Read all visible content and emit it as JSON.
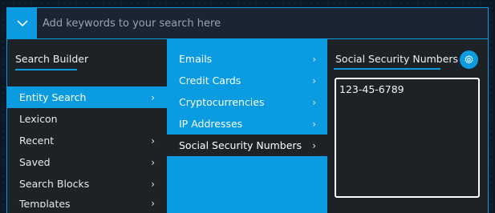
{
  "search": {
    "placeholder": "Add keywords to your search here",
    "value": ""
  },
  "builder": {
    "title": "Search Builder",
    "items": [
      {
        "label": "Entity Search",
        "chevron": "›",
        "active": true
      },
      {
        "label": "Lexicon",
        "chevron": "",
        "active": false
      },
      {
        "label": "Recent",
        "chevron": "›",
        "active": false
      },
      {
        "label": "Saved",
        "chevron": "›",
        "active": false
      },
      {
        "label": "Search Blocks",
        "chevron": "›",
        "active": false
      },
      {
        "label": "Templates",
        "chevron": "›",
        "active": false
      }
    ]
  },
  "entities": {
    "items": [
      {
        "label": "Emails",
        "chevron": "›",
        "active": false
      },
      {
        "label": "Credit Cards",
        "chevron": "›",
        "active": false
      },
      {
        "label": "Cryptocurrencies",
        "chevron": "›",
        "active": false
      },
      {
        "label": "IP Addresses",
        "chevron": "›",
        "active": false
      },
      {
        "label": "Social Security Numbers",
        "chevron": "›",
        "active": true
      }
    ]
  },
  "ssn_panel": {
    "title": "Social Security Numbers",
    "value": "123-45-6789",
    "settings_icon": "gear-icon"
  },
  "colors": {
    "accent": "#0a9be0",
    "panel": "#1d2227",
    "background": "#0b1826"
  }
}
